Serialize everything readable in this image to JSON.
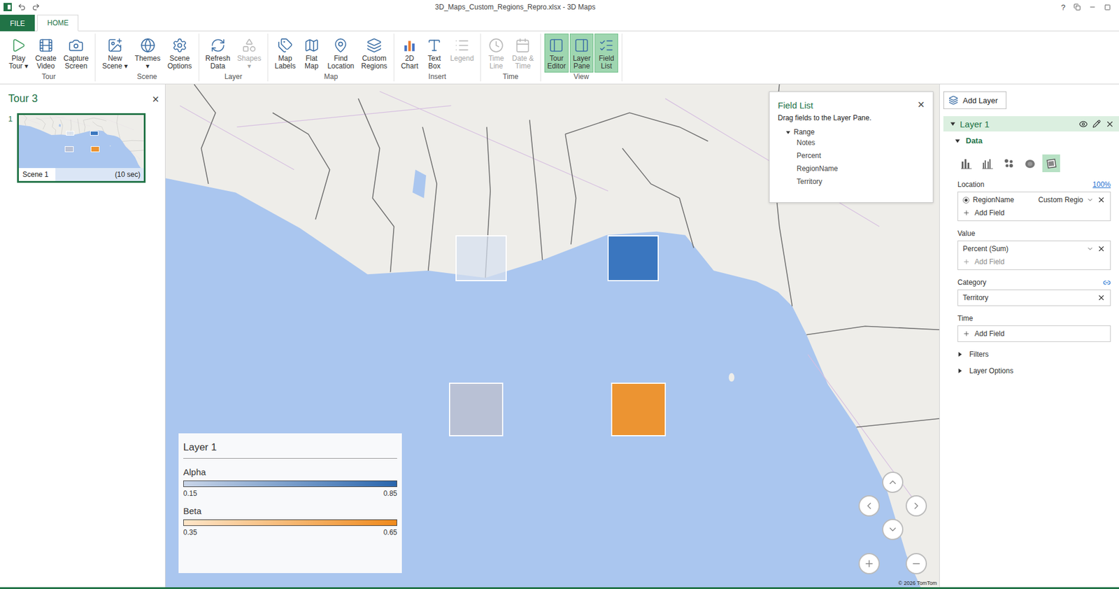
{
  "window": {
    "title": "3D_Maps_Custom_Regions_Repro.xlsx - 3D Maps",
    "help": "?"
  },
  "ribbon_tabs": [
    {
      "label": "FILE",
      "kind": "file",
      "selected": false
    },
    {
      "label": "HOME",
      "kind": "tab",
      "selected": true
    }
  ],
  "ribbon_groups": [
    {
      "label": "Tour",
      "buttons": [
        {
          "lines": [
            "Play",
            "Tour ▾"
          ],
          "disabled": false,
          "selected": false
        },
        {
          "lines": [
            "Create",
            "Video"
          ],
          "disabled": false,
          "selected": false
        },
        {
          "lines": [
            "Capture",
            "Screen"
          ],
          "disabled": false,
          "selected": false
        }
      ]
    },
    {
      "label": "Scene",
      "buttons": [
        {
          "lines": [
            "New",
            "Scene ▾"
          ],
          "disabled": false,
          "selected": false
        },
        {
          "lines": [
            "Themes",
            "▾"
          ],
          "disabled": false,
          "selected": false
        },
        {
          "lines": [
            "Scene",
            "Options"
          ],
          "disabled": false,
          "selected": false
        }
      ]
    },
    {
      "label": "Layer",
      "buttons": [
        {
          "lines": [
            "Refresh",
            "Data"
          ],
          "disabled": false,
          "selected": false
        },
        {
          "lines": [
            "Shapes",
            "▾"
          ],
          "disabled": true,
          "selected": false
        }
      ]
    },
    {
      "label": "Map",
      "buttons": [
        {
          "lines": [
            "Map",
            "Labels"
          ],
          "disabled": false,
          "selected": false
        },
        {
          "lines": [
            "Flat",
            "Map"
          ],
          "disabled": false,
          "selected": false
        },
        {
          "lines": [
            "Find",
            "Location"
          ],
          "disabled": false,
          "selected": false
        },
        {
          "lines": [
            "Custom",
            "Regions"
          ],
          "disabled": false,
          "selected": false
        }
      ]
    },
    {
      "label": "Insert",
      "buttons": [
        {
          "lines": [
            "2D",
            "Chart"
          ],
          "disabled": false,
          "selected": false
        },
        {
          "lines": [
            "Text",
            "Box"
          ],
          "disabled": false,
          "selected": false
        },
        {
          "lines": [
            "Legend"
          ],
          "disabled": true,
          "selected": false
        }
      ]
    },
    {
      "label": "Time",
      "buttons": [
        {
          "lines": [
            "Time",
            "Line"
          ],
          "disabled": true,
          "selected": false
        },
        {
          "lines": [
            "Date &",
            "Time"
          ],
          "disabled": true,
          "selected": false
        }
      ]
    },
    {
      "label": "View",
      "buttons": [
        {
          "lines": [
            "Tour",
            "Editor"
          ],
          "disabled": false,
          "selected": true
        },
        {
          "lines": [
            "Layer",
            "Pane"
          ],
          "disabled": false,
          "selected": true
        },
        {
          "lines": [
            "Field",
            "List"
          ],
          "disabled": false,
          "selected": true
        }
      ]
    }
  ],
  "tour": {
    "title": "Tour 3",
    "close": "×",
    "scenes": [
      {
        "number": "1",
        "name": "Scene 1",
        "duration": "(10 sec)",
        "selected": true
      }
    ]
  },
  "map": {
    "regions": [
      {
        "color": "#d6e0efb3"
      },
      {
        "color": "#3a76bf"
      },
      {
        "color": "#b9c1d5"
      },
      {
        "color": "#ec9432"
      }
    ],
    "copyright": "© 2026 TomTom"
  },
  "legend": {
    "title": "Layer 1",
    "series": [
      {
        "name": "Alpha",
        "min": "0.15",
        "max": "0.85",
        "from": "#c9d5e8",
        "to": "#2a66ad"
      },
      {
        "name": "Beta",
        "min": "0.35",
        "max": "0.65",
        "from": "#fde5c8",
        "to": "#ef8a1d"
      }
    ]
  },
  "field_list": {
    "title": "Field List",
    "hint": "Drag fields to the Layer Pane.",
    "close": "×",
    "groups": [
      {
        "name": "Range",
        "expanded": true,
        "fields": [
          "Notes",
          "Percent",
          "RegionName",
          "Territory"
        ]
      }
    ]
  },
  "layer_pane": {
    "add_layer": "Add Layer",
    "layers": [
      {
        "name": "Layer 1",
        "expanded": true,
        "visible": true
      }
    ],
    "data_section": {
      "title": "Data",
      "expanded": true
    },
    "chart_types": [
      {
        "selected": false
      },
      {
        "selected": false
      },
      {
        "selected": false
      },
      {
        "selected": false
      },
      {
        "selected": true
      }
    ],
    "location": {
      "label": "Location",
      "link": "100%",
      "fields": [
        {
          "name": "RegionName",
          "type": "Custom Regio",
          "selected": true
        }
      ],
      "add": "Add Field"
    },
    "value": {
      "label": "Value",
      "fields": [
        {
          "name": "Percent (Sum)"
        }
      ],
      "add": "Add Field",
      "add_disabled": true
    },
    "category": {
      "label": "Category",
      "fields": [
        {
          "name": "Territory"
        }
      ]
    },
    "time": {
      "label": "Time",
      "add": "Add Field"
    },
    "sections": [
      {
        "label": "Filters",
        "expanded": false
      },
      {
        "label": "Layer Options",
        "expanded": false
      }
    ]
  }
}
